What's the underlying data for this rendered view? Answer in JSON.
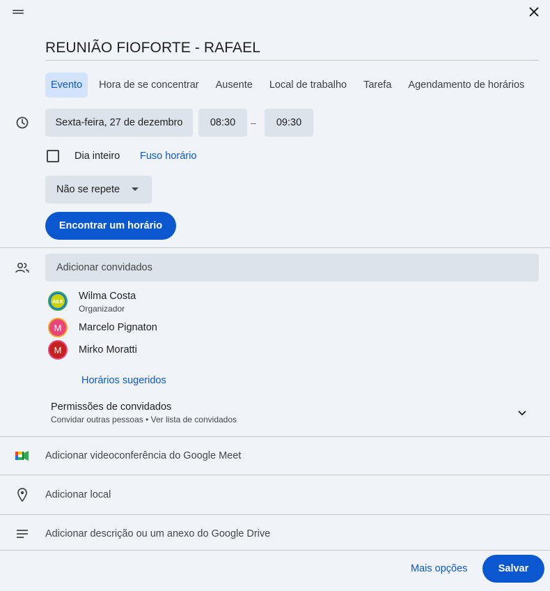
{
  "dialog": {
    "title": "REUNIÃO FIOFORTE - RAFAEL"
  },
  "tabs": [
    {
      "label": "Evento",
      "active": true
    },
    {
      "label": "Hora de se concentrar",
      "active": false
    },
    {
      "label": "Ausente",
      "active": false
    },
    {
      "label": "Local de trabalho",
      "active": false
    },
    {
      "label": "Tarefa",
      "active": false
    },
    {
      "label": "Agendamento de horários",
      "active": false
    }
  ],
  "time": {
    "date": "Sexta-feira, 27 de dezembro",
    "start": "08:30",
    "separator": "–",
    "end": "09:30",
    "all_day_label": "Dia inteiro",
    "all_day_checked": false,
    "timezone_link": "Fuso horário",
    "repeat": "Não se repete",
    "find_time_button": "Encontrar um horário"
  },
  "guests": {
    "placeholder": "Adicionar convidados",
    "list": [
      {
        "name": "Wilma Costa",
        "role": "Organizador",
        "avatar": "logo",
        "color": "#1a73e8"
      },
      {
        "name": "Marcelo Pignaton",
        "role": "",
        "avatar": "M",
        "color": "#e8457a"
      },
      {
        "name": "Mirko Moratti",
        "role": "",
        "avatar": "M",
        "color": "#c5221f"
      }
    ],
    "suggested_times": "Horários sugeridos",
    "permissions_title": "Permissões de convidados",
    "permissions_sub": "Convidar outras pessoas • Ver lista de convidados"
  },
  "rows": {
    "meet": "Adicionar videoconferência do Google Meet",
    "location": "Adicionar local",
    "description": "Adicionar descrição ou um anexo do Google Drive"
  },
  "footer": {
    "more_options": "Mais opções",
    "save": "Salvar"
  },
  "colors": {
    "accent": "#0b57d0",
    "background": "#f0f4f9",
    "field": "#dde3ea"
  }
}
